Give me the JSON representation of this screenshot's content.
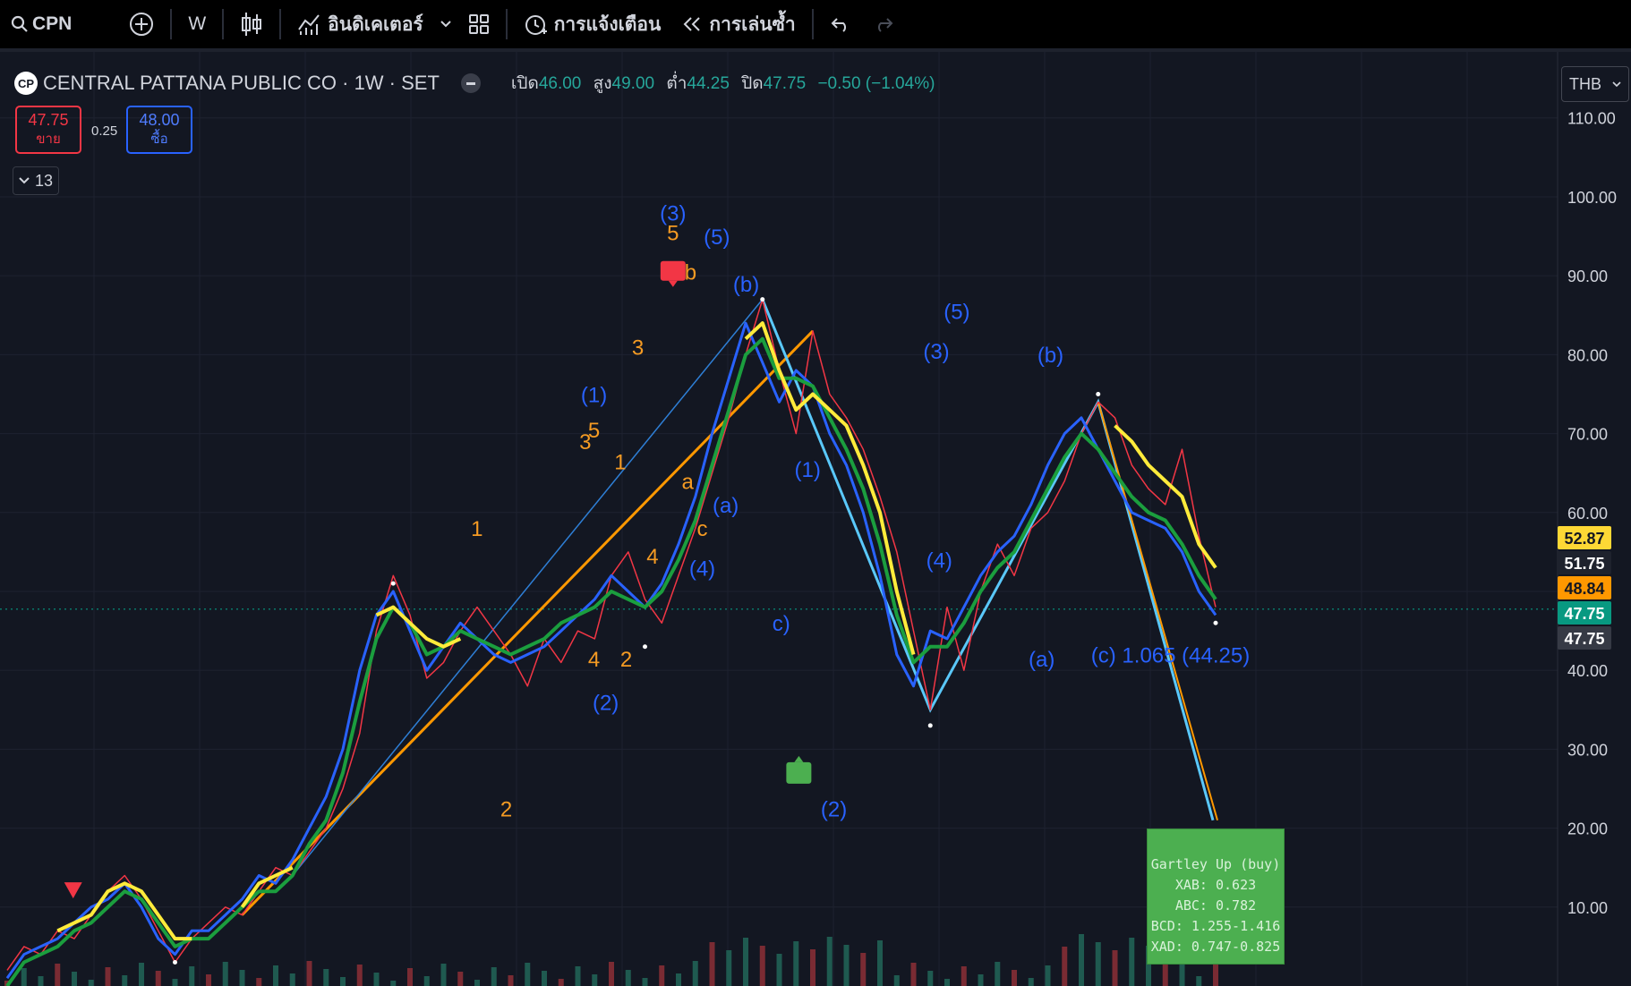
{
  "toolbar": {
    "symbol": "CPN",
    "interval": "W",
    "indicators_label": "อินดิเคเตอร์",
    "alerts_label": "การแจ้งเตือน",
    "replay_label": "การเล่นซ้ำ"
  },
  "legend": {
    "logo_text": "CP",
    "title": "CENTRAL PATTANA PUBLIC CO · 1W · SET",
    "open_label": "เปิด",
    "open": "46.00",
    "high_label": "สูง",
    "high": "49.00",
    "low_label": "ต่ำ",
    "low": "44.25",
    "close_label": "ปิด",
    "close": "47.75",
    "change": "−0.50 (−1.04%)",
    "up_color": "#26a69a"
  },
  "trade": {
    "sell_price": "47.75",
    "sell_label": "ขาย",
    "spread": "0.25",
    "buy_price": "48.00",
    "buy_label": "ซื้อ",
    "collapse_count": "13"
  },
  "currency": "THB",
  "pattern_box": {
    "lines": [
      "Gartley  Up (buy)",
      "XAB: 0.623",
      "ABC: 0.782",
      "BCD: 1.255-1.416",
      "XAD: 0.747-0.825"
    ],
    "color": "#4caf50"
  },
  "chart_data": {
    "type": "line",
    "title": "CENTRAL PATTANA PUBLIC CO · 1W · SET",
    "ylim": [
      0,
      117
    ],
    "y_ticks": [
      "110.00",
      "100.00",
      "90.00",
      "80.00",
      "70.00",
      "60.00",
      "50.00",
      "40.00",
      "30.00",
      "20.00",
      "10.00"
    ],
    "y_tick_values": [
      110,
      100,
      90,
      80,
      70,
      60,
      50,
      40,
      30,
      20,
      10
    ],
    "grid": true,
    "price_tags": [
      {
        "label": "52.87",
        "value": 52.87,
        "bg": "#fdd835",
        "fg": "#131722"
      },
      {
        "label": "51.75",
        "value": 51.75,
        "bg": "#1e222d",
        "fg": "#ffffff"
      },
      {
        "label": "48.84",
        "value": 48.84,
        "bg": "#ff9800",
        "fg": "#131722"
      },
      {
        "label": "47.75",
        "value": 47.75,
        "bg": "#089981",
        "fg": "#ffffff"
      },
      {
        "label": "47.75",
        "value": 44.6,
        "bg": "#363a45",
        "fg": "#ffffff"
      }
    ],
    "price_line": 47.75,
    "series": [
      {
        "values": [
          2,
          5,
          4,
          7,
          6,
          9,
          12,
          14,
          11,
          7,
          3,
          6,
          8,
          10,
          9,
          12,
          15,
          14,
          17,
          20,
          25,
          32,
          45,
          52,
          47,
          39,
          41,
          45,
          48,
          45,
          42,
          38,
          44,
          41,
          45,
          44,
          52,
          55,
          49,
          46,
          52,
          58,
          65,
          72,
          80,
          87,
          78,
          70,
          83,
          75,
          72,
          68,
          62,
          55,
          45,
          35,
          48,
          40,
          50,
          56,
          52,
          58,
          60,
          64,
          70,
          74,
          72,
          66,
          63,
          61,
          68,
          57,
          48
        ]
      },
      {
        "values": [
          1,
          4,
          5,
          6,
          8,
          10,
          11,
          13,
          10,
          6,
          4,
          7,
          7,
          9,
          11,
          14,
          13,
          16,
          20,
          24,
          30,
          40,
          47,
          50,
          45,
          40,
          43,
          46,
          44,
          42,
          41,
          42,
          43,
          45,
          47,
          49,
          52,
          50,
          48,
          51,
          56,
          62,
          70,
          77,
          84,
          79,
          74,
          78,
          76,
          70,
          66,
          60,
          52,
          42,
          38,
          45,
          44,
          48,
          52,
          55,
          57,
          61,
          66,
          70,
          72,
          68,
          64,
          60,
          59,
          58,
          55,
          50,
          47
        ]
      },
      {
        "values": [
          0,
          3,
          4,
          5,
          7,
          8,
          10,
          12,
          11,
          8,
          5,
          6,
          6,
          8,
          10,
          12,
          12,
          14,
          18,
          21,
          27,
          36,
          44,
          48,
          46,
          42,
          43,
          45,
          44,
          43,
          42,
          43,
          44,
          46,
          47,
          48,
          50,
          49,
          48,
          50,
          54,
          59,
          66,
          73,
          80,
          82,
          77,
          77,
          76,
          72,
          68,
          63,
          56,
          47,
          41,
          43,
          43,
          46,
          50,
          53,
          55,
          59,
          63,
          67,
          70,
          68,
          65,
          62,
          60,
          59,
          56,
          52,
          49
        ]
      },
      {
        "values": [
          null,
          null,
          null,
          7,
          8,
          9,
          12,
          13,
          12,
          9,
          6,
          6,
          null,
          null,
          10,
          13,
          14,
          15,
          null,
          null,
          null,
          null,
          47,
          48,
          46,
          44,
          43,
          44,
          null,
          null,
          null,
          null,
          null,
          null,
          null,
          null,
          null,
          null,
          null,
          null,
          null,
          null,
          null,
          null,
          82,
          84,
          78,
          73,
          75,
          73,
          71,
          66,
          60,
          50,
          42,
          null,
          null,
          null,
          null,
          null,
          null,
          null,
          null,
          null,
          null,
          null,
          71,
          69,
          66,
          64,
          62,
          56,
          53
        ]
      }
    ],
    "annotations": [
      {
        "text": "(3)",
        "color": "#2962ff",
        "x": 23,
        "y": 97
      },
      {
        "text": "5",
        "color": "#f59b23",
        "x": 23,
        "y": 94.5
      },
      {
        "text": "(5)",
        "color": "#2962ff",
        "x": 24.5,
        "y": 94
      },
      {
        "text": "b",
        "color": "#f59b23",
        "x": 23.6,
        "y": 89.5
      },
      {
        "text": "(b)",
        "color": "#2962ff",
        "x": 25.5,
        "y": 88
      },
      {
        "text": "3",
        "color": "#f59b23",
        "x": 21.8,
        "y": 80
      },
      {
        "text": "(1)",
        "color": "#2962ff",
        "x": 20.3,
        "y": 74
      },
      {
        "text": "5",
        "color": "#f59b23",
        "x": 20.3,
        "y": 69.5
      },
      {
        "text": "3",
        "color": "#f59b23",
        "x": 20,
        "y": 68
      },
      {
        "text": "1",
        "color": "#f59b23",
        "x": 21.2,
        "y": 65.5
      },
      {
        "text": "a",
        "color": "#f59b23",
        "x": 23.5,
        "y": 63
      },
      {
        "text": "(a)",
        "color": "#2962ff",
        "x": 24.8,
        "y": 60
      },
      {
        "text": "c",
        "color": "#f59b23",
        "x": 24,
        "y": 57
      },
      {
        "text": "(4)",
        "color": "#2962ff",
        "x": 24,
        "y": 52
      },
      {
        "text": "1",
        "color": "#f59b23",
        "x": 16.3,
        "y": 57
      },
      {
        "text": "4",
        "color": "#f59b23",
        "x": 22.3,
        "y": 53.5
      },
      {
        "text": "4",
        "color": "#f59b23",
        "x": 20.3,
        "y": 40.5
      },
      {
        "text": "2",
        "color": "#f59b23",
        "x": 21.4,
        "y": 40.5
      },
      {
        "text": "(2)",
        "color": "#2962ff",
        "x": 20.7,
        "y": 35
      },
      {
        "text": "2",
        "color": "#f59b23",
        "x": 17.3,
        "y": 21.5
      },
      {
        "text": "(1)",
        "color": "#2962ff",
        "x": 27.6,
        "y": 64.5
      },
      {
        "text": "c)",
        "color": "#2962ff",
        "x": 26.7,
        "y": 45
      },
      {
        "text": "(2)",
        "color": "#2962ff",
        "x": 28.5,
        "y": 21.5
      },
      {
        "text": "(3)",
        "color": "#2962ff",
        "x": 32,
        "y": 79.5
      },
      {
        "text": "(5)",
        "color": "#2962ff",
        "x": 32.7,
        "y": 84.5
      },
      {
        "text": "(4)",
        "color": "#2962ff",
        "x": 32.1,
        "y": 53
      },
      {
        "text": "(b)",
        "color": "#2962ff",
        "x": 35.9,
        "y": 79
      },
      {
        "text": "(a)",
        "color": "#2962ff",
        "x": 35.6,
        "y": 40.5
      },
      {
        "text": "(c) 1.065 (44.25)",
        "color": "#2962ff",
        "x": 40,
        "y": 41
      }
    ],
    "markers": [
      {
        "type": "down-triangle",
        "color": "#f23645",
        "x": 2.5,
        "y": 12
      },
      {
        "type": "label-down",
        "color": "#f23645",
        "x": 23,
        "y": 90.5
      },
      {
        "type": "label-up",
        "color": "#4caf50",
        "x": 27.3,
        "y": 27
      }
    ]
  }
}
